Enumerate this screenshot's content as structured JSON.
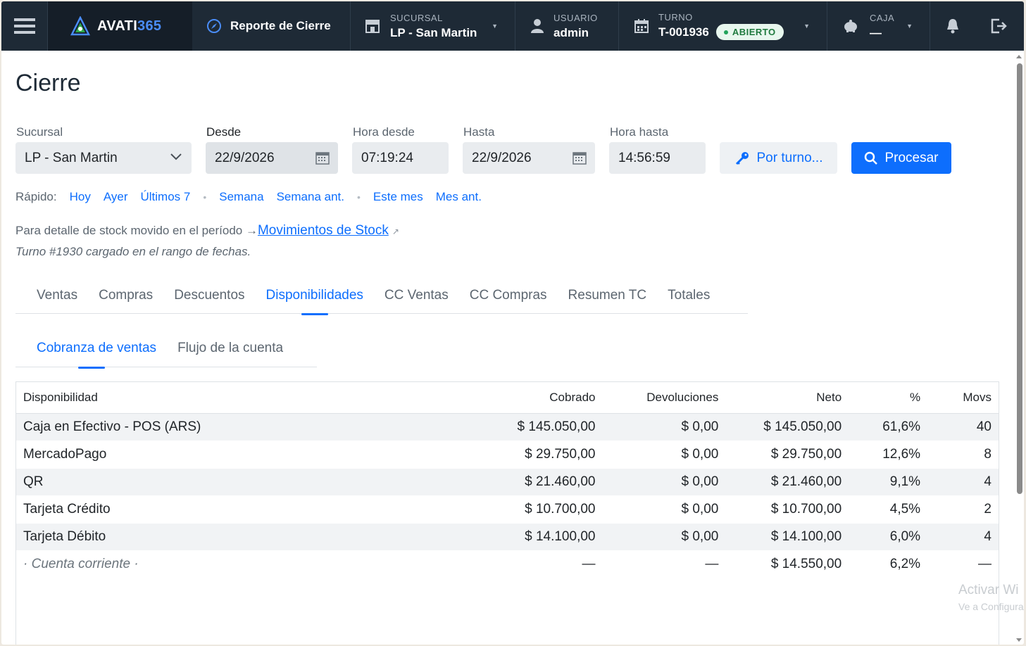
{
  "topbar": {
    "brand": "AVATI",
    "brand_accent": "365",
    "report_title": "Reporte de Cierre",
    "sucursal_label": "SUCURSAL",
    "sucursal_value": "LP - San Martin",
    "usuario_label": "USUARIO",
    "usuario_value": "admin",
    "turno_label": "TURNO",
    "turno_value": "T-001936",
    "turno_status": "ABIERTO",
    "caja_label": "CAJA",
    "caja_value": "—"
  },
  "page": {
    "title": "Cierre"
  },
  "filters": {
    "sucursal_label": "Sucursal",
    "sucursal_value": "LP - San Martin",
    "desde_label": "Desde",
    "desde_value": "22/9/2026",
    "hora_desde_label": "Hora desde",
    "hora_desde_value": "07:19:24",
    "hasta_label": "Hasta",
    "hasta_value": "22/9/2026",
    "hora_hasta_label": "Hora hasta",
    "hora_hasta_value": "14:56:59",
    "por_turno_label": "Por turno...",
    "procesar_label": "Procesar"
  },
  "rapido": {
    "label": "Rápido:",
    "items": [
      "Hoy",
      "Ayer",
      "Últimos 7",
      "Semana",
      "Semana ant.",
      "Este mes",
      "Mes ant."
    ]
  },
  "detalle": {
    "text": "Para detalle de stock movido en el período →",
    "link": "Movimientos de Stock",
    "ext": "↗"
  },
  "turno_note": "Turno #1930 cargado en el rango de fechas.",
  "tabs": [
    "Ventas",
    "Compras",
    "Descuentos",
    "Disponibilidades",
    "CC Ventas",
    "CC Compras",
    "Resumen TC",
    "Totales"
  ],
  "subtabs": [
    "Cobranza de ventas",
    "Flujo de la cuenta"
  ],
  "table": {
    "headers": [
      "Disponibilidad",
      "Cobrado",
      "Devoluciones",
      "Neto",
      "%",
      "Movs"
    ],
    "rows": [
      [
        "Caja en Efectivo - POS (ARS)",
        "$ 145.050,00",
        "$ 0,00",
        "$ 145.050,00",
        "61,6%",
        "40"
      ],
      [
        "MercadoPago",
        "$ 29.750,00",
        "$ 0,00",
        "$ 29.750,00",
        "12,6%",
        "8"
      ],
      [
        "QR",
        "$ 21.460,00",
        "$ 0,00",
        "$ 21.460,00",
        "9,1%",
        "4"
      ],
      [
        "Tarjeta Crédito",
        "$ 10.700,00",
        "$ 0,00",
        "$ 10.700,00",
        "4,5%",
        "2"
      ],
      [
        "Tarjeta Débito",
        "$ 14.100,00",
        "$ 0,00",
        "$ 14.100,00",
        "6,0%",
        "4"
      ],
      [
        "· Cuenta corriente ·",
        "—",
        "—",
        "$ 14.550,00",
        "6,2%",
        "—"
      ]
    ]
  },
  "watermark": {
    "line1": "Activar Wi",
    "line2": "Ve a Configura"
  }
}
